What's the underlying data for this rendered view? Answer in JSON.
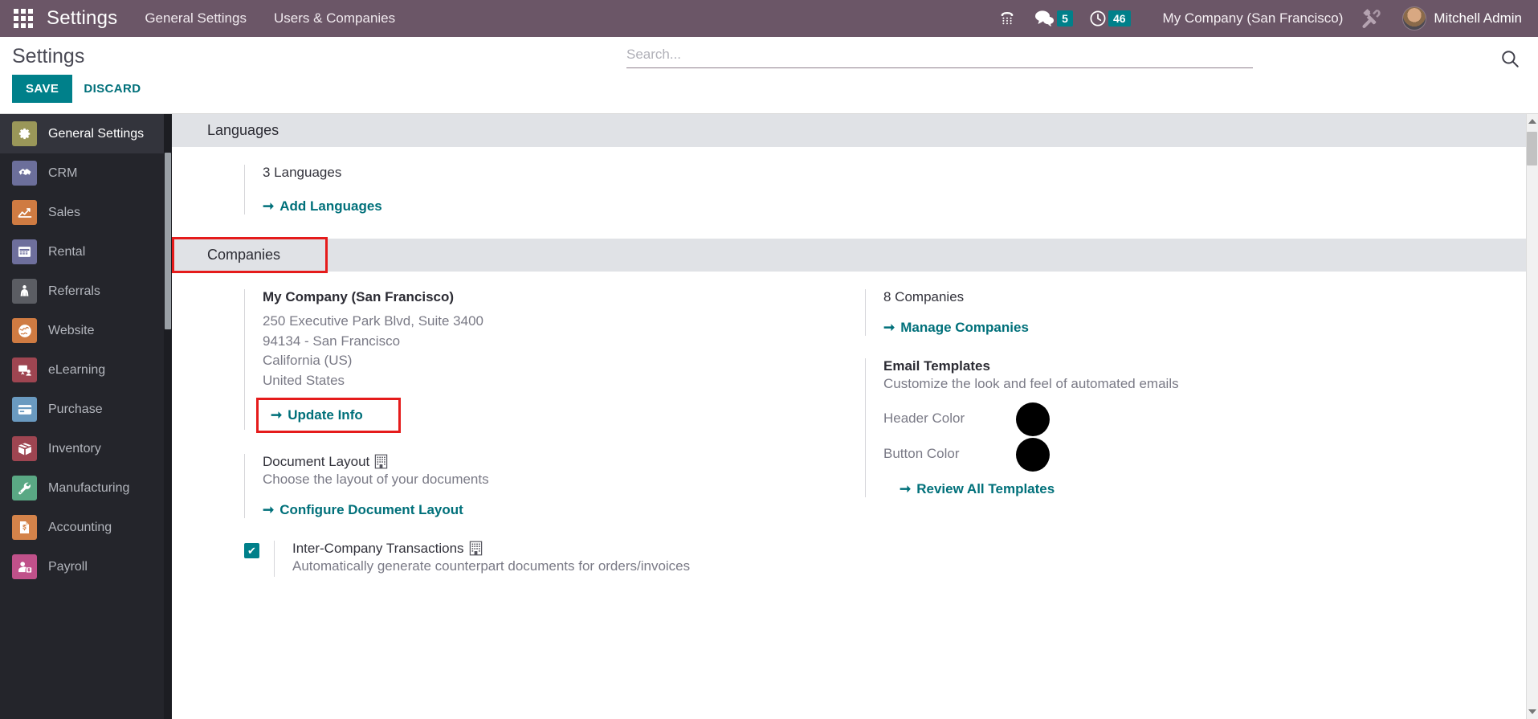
{
  "topbar": {
    "apps_icon": "apps-grid-icon",
    "brand": "Settings",
    "menus": [
      {
        "label": "General Settings"
      },
      {
        "label": "Users & Companies"
      }
    ],
    "phone_icon": "phone-dialpad-icon",
    "messages": {
      "icon": "chat-bubble-icon",
      "count": "5"
    },
    "activities": {
      "icon": "clock-icon",
      "count": "46"
    },
    "company": "My Company (San Francisco)",
    "debug_icon": "tools-wrench-icon",
    "avatar_icon": "user-avatar",
    "user": "Mitchell Admin"
  },
  "controlpanel": {
    "breadcrumb": "Settings",
    "save_label": "SAVE",
    "discard_label": "DISCARD",
    "search_placeholder": "Search...",
    "search_value": "",
    "search_icon": "search-icon"
  },
  "sidebar": {
    "items": [
      {
        "label": "General Settings",
        "icon": "gear-icon",
        "color": "#9a9759",
        "active": true
      },
      {
        "label": "CRM",
        "icon": "handshake-icon",
        "color": "#6c6f9b",
        "active": false
      },
      {
        "label": "Sales",
        "icon": "chart-up-icon",
        "color": "#cf7b42",
        "active": false
      },
      {
        "label": "Rental",
        "icon": "calendar-icon",
        "color": "#6e6f9c",
        "active": false
      },
      {
        "label": "Referrals",
        "icon": "person-gift-icon",
        "color": "#5b5d63",
        "active": false
      },
      {
        "label": "Website",
        "icon": "globe-icon",
        "color": "#cf7b42",
        "active": false
      },
      {
        "label": "eLearning",
        "icon": "presentation-icon",
        "color": "#9e4551",
        "active": false
      },
      {
        "label": "Purchase",
        "icon": "credit-card-icon",
        "color": "#6a9ac0",
        "active": false
      },
      {
        "label": "Inventory",
        "icon": "box-icon",
        "color": "#9e4551",
        "active": false
      },
      {
        "label": "Manufacturing",
        "icon": "wrench-icon",
        "color": "#5aa884",
        "active": false
      },
      {
        "label": "Accounting",
        "icon": "invoice-icon",
        "color": "#d4834a",
        "active": false
      },
      {
        "label": "Payroll",
        "icon": "payroll-icon",
        "color": "#c0518a",
        "active": false
      }
    ]
  },
  "content": {
    "languages": {
      "header": "Languages",
      "count_label": "3 Languages",
      "add_link": "Add Languages"
    },
    "companies": {
      "header": "Companies",
      "header_highlighted": true,
      "left": {
        "company_name": "My Company (San Francisco)",
        "address_lines": [
          "250 Executive Park Blvd, Suite 3400",
          "94134 - San Francisco",
          "California (US)",
          "United States"
        ],
        "update_link": "Update Info",
        "update_link_highlighted": true,
        "document_layout": {
          "title": "Document Layout",
          "icon": "building-external-link-icon",
          "description": "Choose the layout of your documents",
          "link": "Configure Document Layout"
        },
        "inter_company": {
          "checked": true,
          "title": "Inter-Company Transactions",
          "icon": "building-external-link-icon",
          "description": "Automatically generate counterpart documents for orders/invoices"
        }
      },
      "right": {
        "count_label": "8 Companies",
        "manage_link": "Manage Companies",
        "email_templates": {
          "title": "Email Templates",
          "description": "Customize the look and feel of automated emails",
          "header_color_label": "Header Color",
          "header_color_value": "#000000",
          "button_color_label": "Button Color",
          "button_color_value": "#000000",
          "review_link": "Review All Templates"
        }
      }
    },
    "highlight_color": "#e51b1b"
  }
}
